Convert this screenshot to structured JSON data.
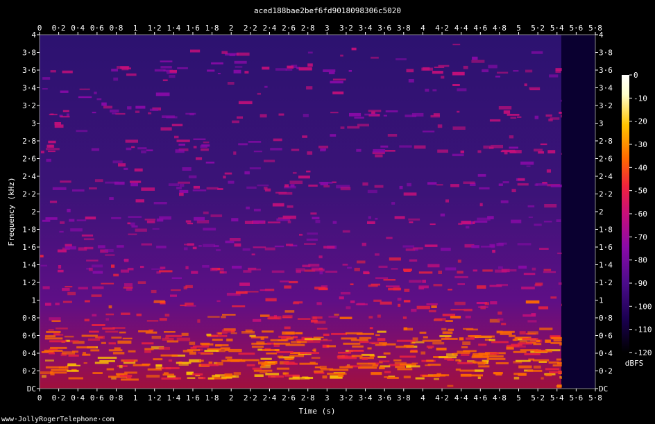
{
  "chart_data": {
    "type": "heatmap",
    "title": "aced188bae2bef6fd9018098306c5020",
    "xlabel": "Time (s)",
    "ylabel": "Frequency (kHz)",
    "xlim": [
      0,
      5.8
    ],
    "ylim": [
      0,
      4
    ],
    "x_ticks": [
      "0",
      "0·2",
      "0·4",
      "0·6",
      "0·8",
      "1",
      "1·2",
      "1·4",
      "1·6",
      "1·8",
      "2",
      "2·2",
      "2·4",
      "2·6",
      "2·8",
      "3",
      "3·2",
      "3·4",
      "3·6",
      "3·8",
      "4",
      "4·2",
      "4·4",
      "4·6",
      "4·8",
      "5",
      "5·2",
      "5·4",
      "5·6",
      "5·8"
    ],
    "y_ticks": [
      "DC",
      "0·2",
      "0·4",
      "0·6",
      "0·8",
      "1",
      "1·2",
      "1·4",
      "1·6",
      "1·8",
      "2",
      "2·2",
      "2·4",
      "2·6",
      "2·8",
      "3",
      "3·2",
      "3·4",
      "3·6",
      "3·8",
      "4"
    ],
    "colorbar": {
      "label": "dBFS",
      "range": [
        -120,
        0
      ],
      "ticks": [
        "0",
        "-10",
        "-20",
        "-30",
        "-40",
        "-50",
        "-60",
        "-70",
        "-80",
        "-90",
        "-100",
        "-110",
        "-120"
      ],
      "colors": [
        "#000000",
        "#1a0050",
        "#4b0c8c",
        "#8a0aa8",
        "#c80f7a",
        "#f0233c",
        "#ff6a00",
        "#ffc400",
        "#ffffcc",
        "#ffffff"
      ]
    },
    "signal_end_s": 5.45,
    "grid": false
  },
  "footer": {
    "watermark": "www·JollyRogerTelephone·com"
  }
}
